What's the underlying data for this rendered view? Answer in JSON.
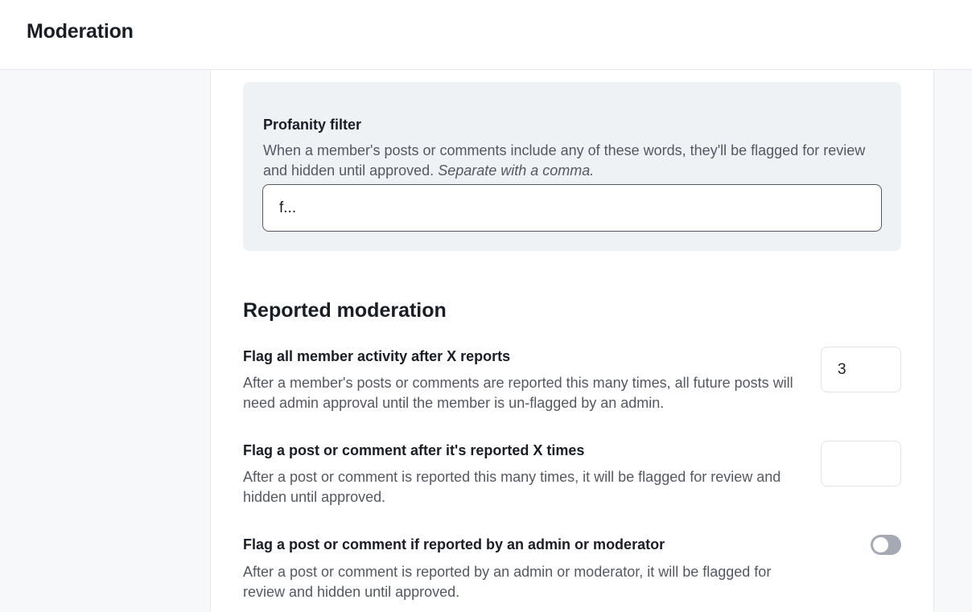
{
  "header": {
    "title": "Moderation"
  },
  "profanity_filter": {
    "title": "Profanity filter",
    "description": "When a member's posts or comments include any of these words, they'll be flagged for review and hidden until approved.",
    "description_hint": "Separate with a comma.",
    "value": "f..."
  },
  "reported_moderation": {
    "title": "Reported moderation",
    "settings": [
      {
        "title": "Flag all member activity after X reports",
        "description": "After a member's posts or comments are reported this many times, all future posts will need admin approval until the member is un-flagged by an admin.",
        "value": "3"
      },
      {
        "title": "Flag a post or comment after it's reported X times",
        "description": "After a post or comment is reported this many times, it will be flagged for review and hidden until approved.",
        "value": ""
      },
      {
        "title": "Flag a post or comment if reported by an admin or moderator",
        "description": "After a post or comment is reported by an admin or moderator, it will be flagged for review and hidden until approved.",
        "enabled": false
      }
    ]
  },
  "colors": {
    "text_primary": "#191d26",
    "text_secondary": "#545861",
    "card_background": "#eff2f5",
    "toggle_off": "#a5a9b3"
  }
}
